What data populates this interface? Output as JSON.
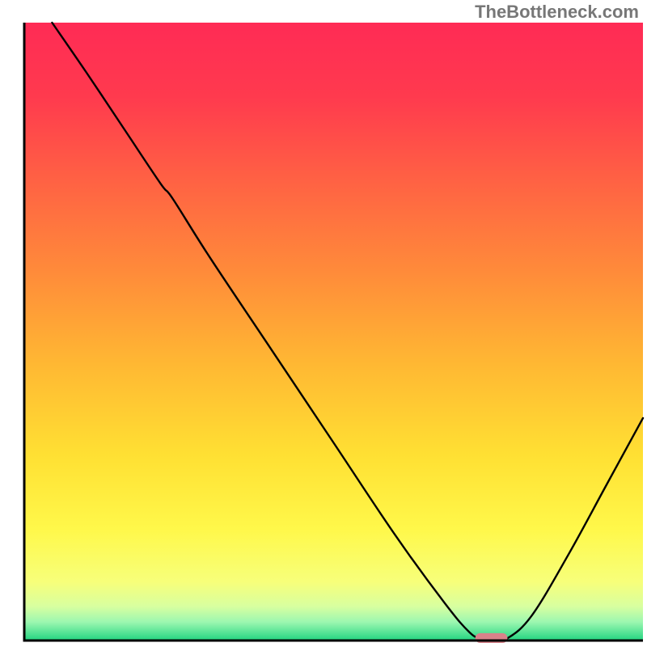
{
  "watermark": "TheBottleneck.com",
  "chart_data": {
    "type": "line",
    "title": "",
    "xlabel": "",
    "ylabel": "",
    "xlim": [
      0,
      100
    ],
    "ylim": [
      0,
      100
    ],
    "axes_visible": false,
    "grid": false,
    "background_gradient": {
      "stops": [
        {
          "offset": 0.0,
          "color": "#ff2b55"
        },
        {
          "offset": 0.12,
          "color": "#ff3a4e"
        },
        {
          "offset": 0.25,
          "color": "#ff6044"
        },
        {
          "offset": 0.4,
          "color": "#ff8a3a"
        },
        {
          "offset": 0.55,
          "color": "#ffb733"
        },
        {
          "offset": 0.7,
          "color": "#ffe033"
        },
        {
          "offset": 0.82,
          "color": "#fff84a"
        },
        {
          "offset": 0.905,
          "color": "#f7ff7a"
        },
        {
          "offset": 0.945,
          "color": "#d8ffa0"
        },
        {
          "offset": 0.97,
          "color": "#9cf7b0"
        },
        {
          "offset": 0.99,
          "color": "#4be091"
        },
        {
          "offset": 1.0,
          "color": "#22d47f"
        }
      ]
    },
    "series": [
      {
        "name": "bottleneck-curve",
        "color": "#000000",
        "stroke_width": 2.4,
        "x": [
          4.5,
          10,
          16,
          22,
          24,
          30,
          40,
          50,
          60,
          68,
          72,
          74,
          76,
          78,
          82,
          88,
          94,
          100
        ],
        "y": [
          100,
          92,
          83,
          74,
          71.5,
          62,
          47,
          32,
          17,
          6,
          1.3,
          0.3,
          0.1,
          0.3,
          4,
          14,
          25,
          36
        ]
      }
    ],
    "marker": {
      "name": "optimal-point",
      "shape": "rounded-rect",
      "color": "#d9828a",
      "cx": 75.5,
      "cy": 0.4,
      "width": 5.2,
      "height": 1.6,
      "rx": 0.8
    },
    "frame": {
      "stroke": "#000000",
      "stroke_width": 3,
      "sides": [
        "left",
        "bottom"
      ]
    }
  }
}
